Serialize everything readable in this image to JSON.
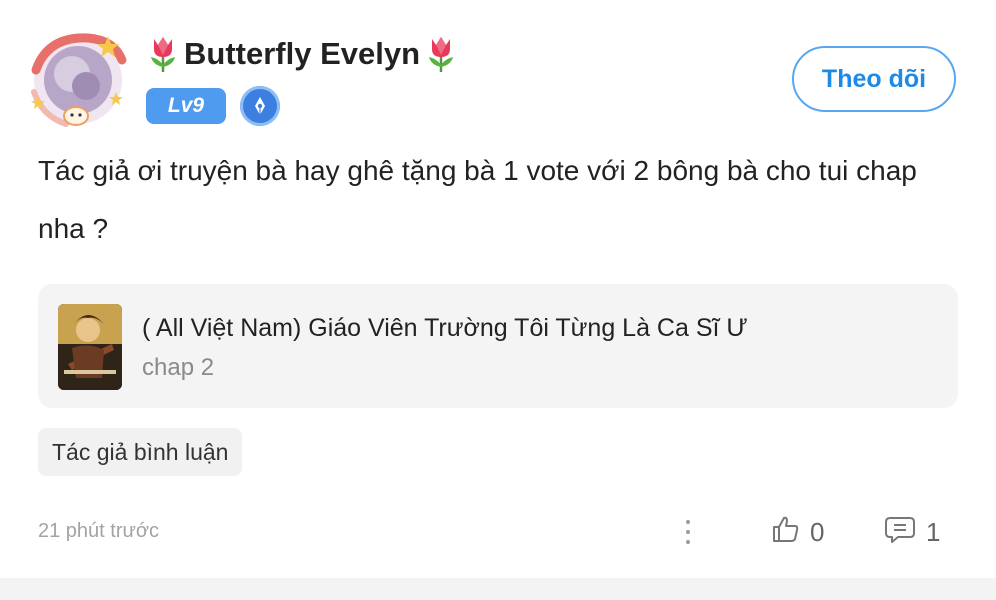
{
  "user": {
    "name": "Butterfly Evelyn",
    "level": "Lv9"
  },
  "icons": {
    "avatar": "avatar-image",
    "decoration": "tulip-icon",
    "author_badge": "pen-badge-icon",
    "more": "more-vertical-icon",
    "like": "thumbs-up-icon",
    "comment": "comment-bubble-icon"
  },
  "colors": {
    "accent": "#1d8ae8",
    "level_badge": "#4f9bf0"
  },
  "follow_button": {
    "label": "Theo dõi"
  },
  "comment": {
    "text": "Tác giả ơi truyện bà hay ghê tặng bà 1 vote với 2 bông bà cho tui chap nha ?"
  },
  "story": {
    "title": "( All Việt Nam) Giáo Viên Trường Tôi Từng Là Ca Sĩ Ư",
    "chapter": "chap 2"
  },
  "author_tag": {
    "label": "Tác giả bình luận"
  },
  "footer": {
    "timestamp": "21 phút trước",
    "likes": "0",
    "replies": "1"
  }
}
